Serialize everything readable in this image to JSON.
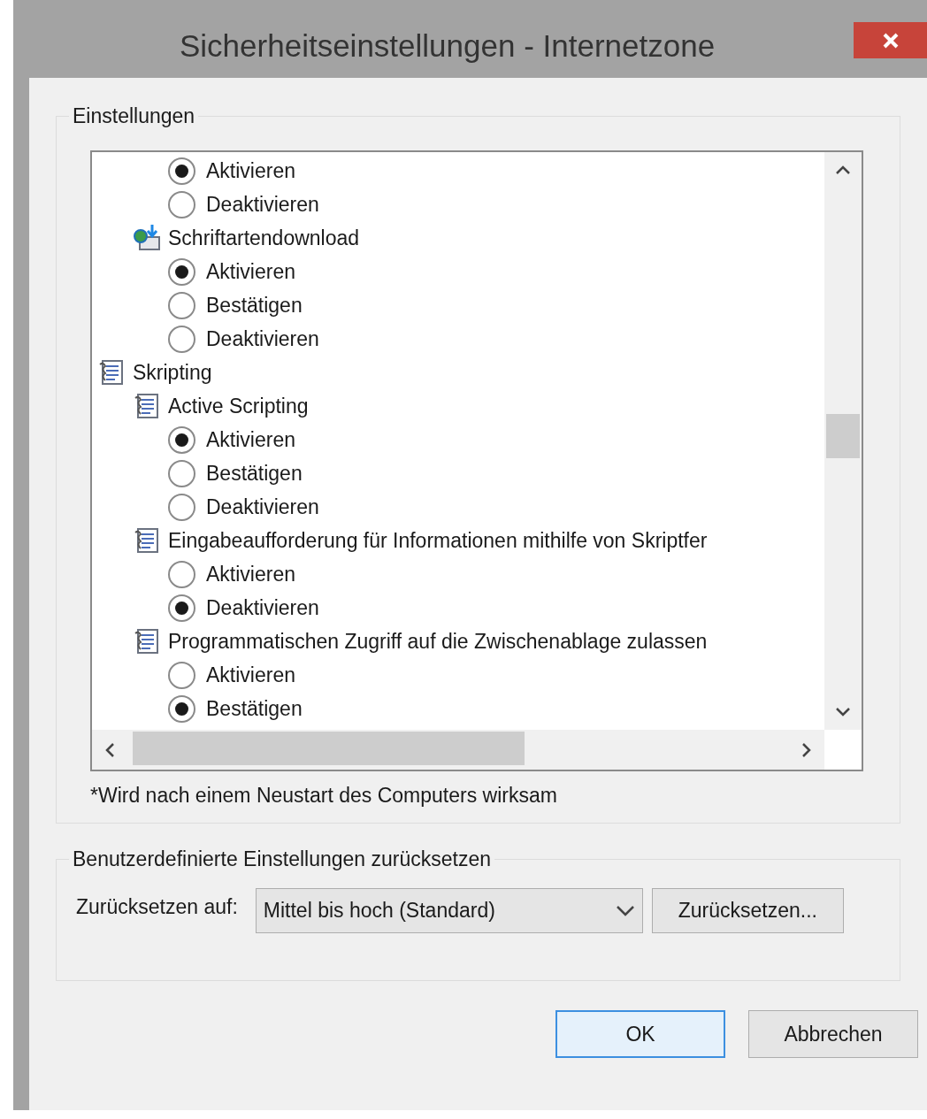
{
  "window": {
    "title": "Sicherheitseinstellungen - Internetzone"
  },
  "settings": {
    "legend": "Einstellungen",
    "tree": [
      {
        "kind": "category",
        "children": [
          {
            "kind": "category",
            "children": [
              {
                "kind": "option",
                "label": "Aktivieren",
                "selected": true
              },
              {
                "kind": "option",
                "label": "Deaktivieren",
                "selected": false
              }
            ]
          },
          {
            "kind": "download",
            "label": "Schriftartendownload",
            "children": [
              {
                "kind": "option",
                "label": "Aktivieren",
                "selected": true
              },
              {
                "kind": "option",
                "label": "Bestätigen",
                "selected": false
              },
              {
                "kind": "option",
                "label": "Deaktivieren",
                "selected": false
              }
            ]
          }
        ]
      },
      {
        "kind": "category",
        "label": "Skripting",
        "children": [
          {
            "kind": "category",
            "label": "Active Scripting",
            "children": [
              {
                "kind": "option",
                "label": "Aktivieren",
                "selected": true
              },
              {
                "kind": "option",
                "label": "Bestätigen",
                "selected": false
              },
              {
                "kind": "option",
                "label": "Deaktivieren",
                "selected": false
              }
            ]
          },
          {
            "kind": "category",
            "label": "Eingabeaufforderung für Informationen mithilfe von Skriptfer",
            "children": [
              {
                "kind": "option",
                "label": "Aktivieren",
                "selected": false
              },
              {
                "kind": "option",
                "label": "Deaktivieren",
                "selected": true
              }
            ]
          },
          {
            "kind": "category",
            "label": "Programmatischen Zugriff auf die Zwischenablage zulassen",
            "children": [
              {
                "kind": "option",
                "label": "Aktivieren",
                "selected": false
              },
              {
                "kind": "option",
                "label": "Bestätigen",
                "selected": true
              }
            ]
          }
        ]
      }
    ],
    "footnote": "*Wird nach einem Neustart des Computers wirksam"
  },
  "reset": {
    "legend": "Benutzerdefinierte Einstellungen zurücksetzen",
    "label": "Zurücksetzen auf:",
    "select": {
      "value": "Mittel bis hoch (Standard)"
    },
    "button": "Zurücksetzen..."
  },
  "buttons": [
    {
      "label": "OK",
      "default": true
    },
    {
      "label": "Abbrechen",
      "default": false
    }
  ]
}
